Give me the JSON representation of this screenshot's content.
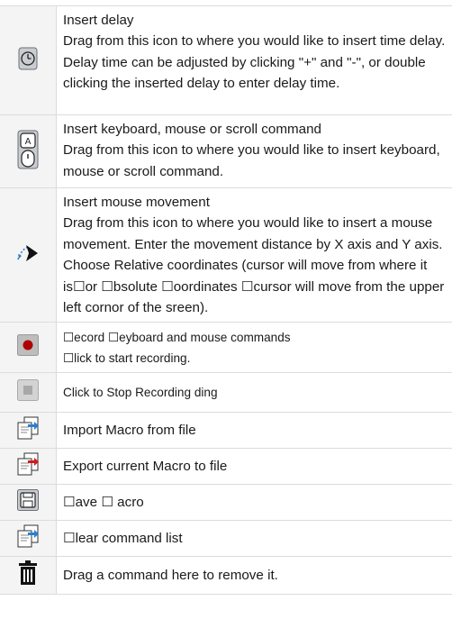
{
  "rows": [
    {
      "icon": "clock-icon",
      "title": "Insert delay",
      "lines": [
        "Drag from this icon to where you would like to insert time delay.",
        "Delay time can be adjusted by clicking \"+\" and \"-\", or double clicking the inserted delay to enter delay time."
      ]
    },
    {
      "icon": "keyboard-mouse-icon",
      "title": "Insert keyboard, mouse or scroll command",
      "lines": [
        "Drag from this icon to where you would like to insert keyboard, mouse or scroll command."
      ]
    },
    {
      "icon": "mouse-movement-icon",
      "title": "Insert mouse movement",
      "lines": [
        "Drag from this icon to where you would like to insert a mouse movement.  Enter the movement distance by X axis and Y axis.  Choose Relative coordinates (cursor will move from where it is☐or ☐bsolute ☐oordinates ☐cursor will move from the upper left cornor of the sreen)."
      ]
    },
    {
      "icon": "record-icon",
      "title": "☐ecord ☐eyboard and mouse commands",
      "lines": [
        "☐lick to start recording."
      ]
    },
    {
      "icon": "stop-icon",
      "title": "Click to Stop Recording ding",
      "lines": []
    },
    {
      "icon": "import-file-icon",
      "title": "Import Macro from file",
      "lines": []
    },
    {
      "icon": "export-file-icon",
      "title": "Export current Macro to file",
      "lines": []
    },
    {
      "icon": "save-icon",
      "title": "☐ave ☐ acro",
      "lines": []
    },
    {
      "icon": "clear-list-icon",
      "title": "☐lear command list",
      "lines": []
    },
    {
      "icon": "trash-icon",
      "title": "Drag a command here to remove it.",
      "lines": []
    }
  ]
}
